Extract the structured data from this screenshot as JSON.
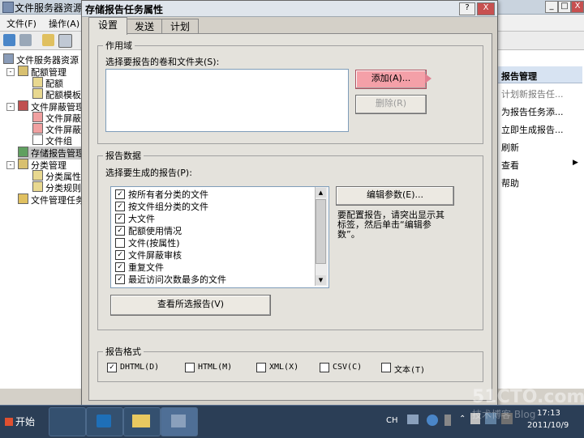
{
  "bg_window": {
    "title": "文件服务器资源",
    "menu": [
      "文件(F)",
      "操作(A)"
    ],
    "controls": [
      "_",
      "□",
      "X"
    ]
  },
  "tree": {
    "items": [
      "文件服务器资源",
      "配额管理",
      "配额",
      "配额模板",
      "文件屏蔽管理",
      "文件屏蔽",
      "文件屏蔽",
      "文件组",
      "存储报告管理",
      "分类管理",
      "分类属性",
      "分类规则",
      "文件管理任务"
    ]
  },
  "actions": {
    "header": "报告管理",
    "items": [
      "计划新报告任...",
      "为报告任务添...",
      "立即生成报告...",
      "刷新",
      "查看",
      "帮助"
    ]
  },
  "dialog": {
    "title": "存储报告任务属性",
    "help": "?",
    "close": "X",
    "tabs": [
      "设置",
      "发送",
      "计划"
    ],
    "scope": {
      "legend": "作用域",
      "label": "选择要报告的卷和文件夹(S):",
      "add_button": "添加(A)...",
      "remove_button": "删除(R)"
    },
    "report_data": {
      "legend": "报告数据",
      "label": "选择要生成的报告(P):",
      "reports": [
        {
          "label": "按所有者分类的文件",
          "checked": true
        },
        {
          "label": "按文件组分类的文件",
          "checked": true
        },
        {
          "label": "大文件",
          "checked": true
        },
        {
          "label": "配额使用情况",
          "checked": true
        },
        {
          "label": "文件(按属性)",
          "checked": false
        },
        {
          "label": "文件屏蔽审核",
          "checked": true
        },
        {
          "label": "重复文件",
          "checked": true
        },
        {
          "label": "最近访问次数最多的文件",
          "checked": true
        }
      ],
      "edit_params_button": "编辑参数(E)...",
      "hint": "要配置报告，请突出显示其标签，然后单击“编辑参数”。",
      "view_reports_button": "查看所选报告(V)"
    },
    "format": {
      "legend": "报告格式",
      "options": [
        {
          "label": "DHTML(D)",
          "checked": true
        },
        {
          "label": "HTML(M)",
          "checked": false
        },
        {
          "label": "XML(X)",
          "checked": false
        },
        {
          "label": "CSV(C)",
          "checked": false
        },
        {
          "label": "文本(T)",
          "checked": false
        }
      ]
    }
  },
  "taskbar": {
    "start": "开始",
    "lang": "CH",
    "time": "17:13",
    "date": "2011/10/9"
  },
  "watermark": {
    "line1": "51CTO.com",
    "line2": "技术博客 Blog"
  }
}
